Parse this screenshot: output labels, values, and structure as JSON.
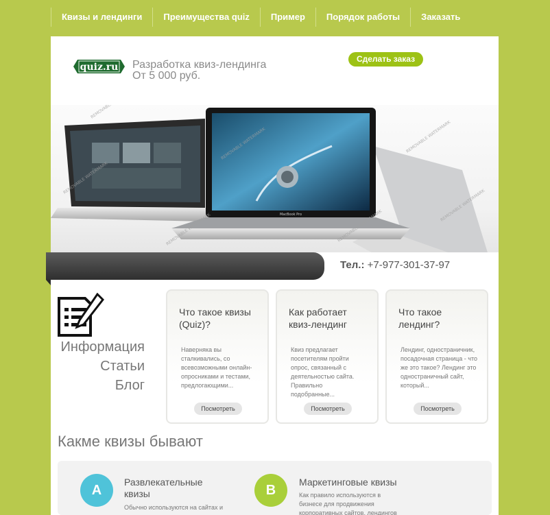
{
  "nav": {
    "items": [
      {
        "label": "Квизы и лендинги"
      },
      {
        "label": "Преимущества quiz"
      },
      {
        "label": "Пример"
      },
      {
        "label": "Порядок работы"
      },
      {
        "label": "Заказать"
      }
    ]
  },
  "header": {
    "logo_text": "quiz.ru",
    "tagline_line1": "Разработка квиз-лендинга",
    "tagline_line2": "От 5 000 руб.",
    "order_button": "Сделать заказ"
  },
  "banner": {
    "watermark_text": "REMOVABLE WATERMARK",
    "laptop_label": "MacBook Pro"
  },
  "contact": {
    "phone_label": "Тел.:",
    "phone_number": "+7-977-301-37-97"
  },
  "sidebar": {
    "links": [
      {
        "label": "Информация"
      },
      {
        "label": "Статьи"
      },
      {
        "label": "Блог"
      }
    ]
  },
  "cards": [
    {
      "title": "Что такое квизы (Quiz)?",
      "text": "Наверняка вы сталкивались, со всевозможными онлайн-опросниками и тестами, предлогающими...",
      "button": "Посмотреть"
    },
    {
      "title": "Как работает квиз-лендинг",
      "text": "Квиз предлагает посетителям пройти опрос, связанный с деятельностью сайта. Правильно подобранные...",
      "button": "Посмотреть"
    },
    {
      "title": "Что такое лендинг?",
      "text": "Лендинг, одностраничник, посадочная страница - что же это такое? Лендинг это одностраничный сайт, который...",
      "button": "Посмотреть"
    }
  ],
  "quiz_types": {
    "section_title": "Какме квизы бывают",
    "items": [
      {
        "letter": "A",
        "title": "Развлекательные квизы",
        "text": "Обычно используются на сайтах и в",
        "color": "#4fc3d9"
      },
      {
        "letter": "B",
        "title": "Маркетинговые квизы",
        "text": "Как правило используются в бизнесе для продвижения корпоративных сайтов, лендингов",
        "color": "#a9cf3a"
      }
    ]
  },
  "colors": {
    "background": "#b8c94d",
    "accent_button": "#9dc215",
    "logo_green": "#1f6b2f"
  }
}
